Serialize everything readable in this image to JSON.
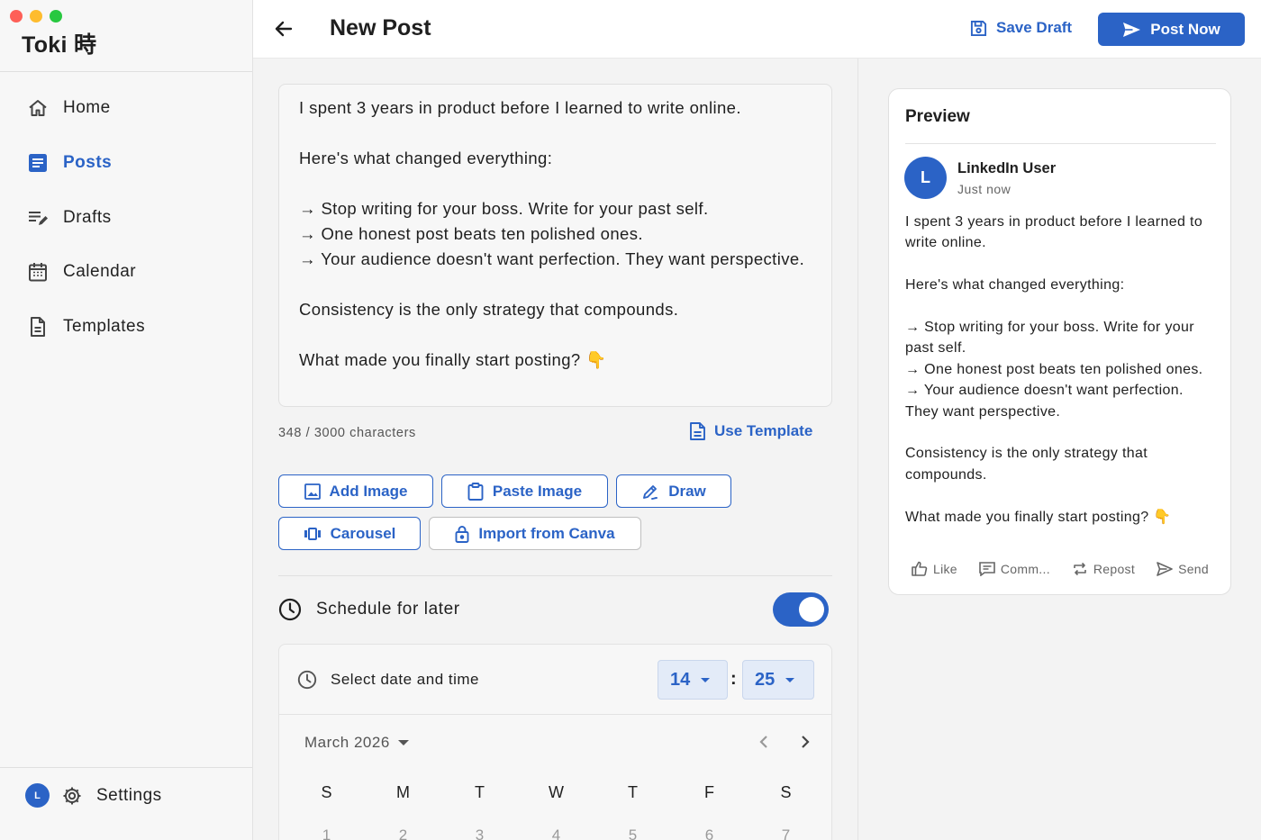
{
  "app": {
    "brand": "Toki 時"
  },
  "sidebar": {
    "items": [
      {
        "label": "Home",
        "icon": "home-icon"
      },
      {
        "label": "Posts",
        "icon": "posts-icon",
        "active": true
      },
      {
        "label": "Drafts",
        "icon": "drafts-icon"
      },
      {
        "label": "Calendar",
        "icon": "calendar-icon"
      },
      {
        "label": "Templates",
        "icon": "templates-icon"
      }
    ],
    "user_initial": "L",
    "settings_label": "Settings"
  },
  "header": {
    "title": "New Post",
    "save_draft_label": "Save Draft",
    "post_now_label": "Post Now"
  },
  "editor": {
    "text": "I spent 3 years in product before I learned to write online.\n\nHere's what changed everything:\n\n→ Stop writing for your boss. Write for your past self.\n→ One honest post beats ten polished ones.\n→ Your audience doesn't want perfection. They want perspective.\n\nConsistency is the only strategy that compounds.\n\nWhat made you finally start posting? 👇",
    "char_count": "348 / 3000 characters",
    "use_template_label": "Use Template"
  },
  "media_buttons": {
    "add_image": "Add Image",
    "paste_image": "Paste Image",
    "draw": "Draw",
    "carousel": "Carousel",
    "import_canva": "Import from Canva"
  },
  "schedule": {
    "label": "Schedule for later",
    "enabled": true,
    "select_label": "Select date and time",
    "hour": "14",
    "minute": "25",
    "separator": ":",
    "month": "March 2026",
    "weekdays": [
      "S",
      "M",
      "T",
      "W",
      "T",
      "F",
      "S"
    ],
    "first_week": [
      "1",
      "2",
      "3",
      "4",
      "5",
      "6",
      "7"
    ]
  },
  "preview": {
    "title": "Preview",
    "avatar_initial": "L",
    "user_name": "LinkedIn User",
    "timestamp": "Just now",
    "text": "I spent 3 years in product before I learned to write online.\n\nHere's what changed everything:\n\n→ Stop writing for your boss. Write for your past self.\n→ One honest post beats ten polished ones.\n→ Your audience doesn't want perfection. They want perspective.\n\nConsistency is the only strategy that compounds.\n\nWhat made you finally start posting? 👇",
    "actions": {
      "like": "Like",
      "comment": "Comm...",
      "repost": "Repost",
      "send": "Send"
    }
  },
  "colors": {
    "accent": "#2b63c6",
    "toggle_on": "#2b63c6"
  }
}
